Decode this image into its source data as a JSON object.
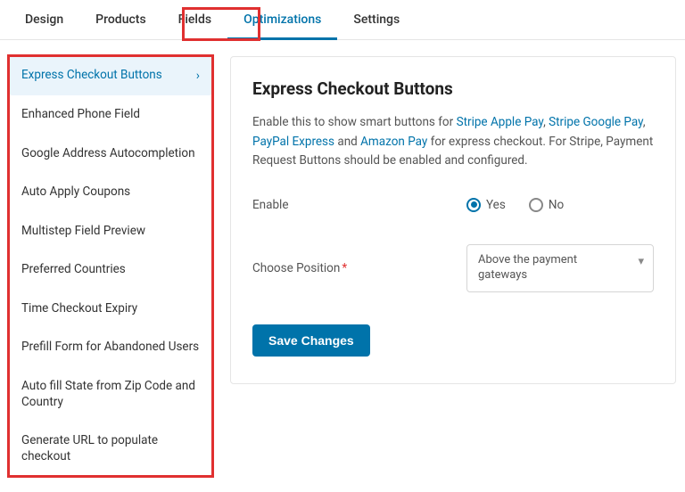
{
  "tabs": [
    "Design",
    "Products",
    "Fields",
    "Optimizations",
    "Settings"
  ],
  "activeTab": "Optimizations",
  "sidebar": {
    "items": [
      {
        "label": "Express Checkout Buttons",
        "active": true
      },
      {
        "label": "Enhanced Phone Field"
      },
      {
        "label": "Google Address Autocompletion"
      },
      {
        "label": "Auto Apply Coupons"
      },
      {
        "label": "Multistep Field Preview"
      },
      {
        "label": "Preferred Countries"
      },
      {
        "label": "Time Checkout Expiry"
      },
      {
        "label": "Prefill Form for Abandoned Users"
      },
      {
        "label": "Auto fill State from Zip Code and Country"
      },
      {
        "label": "Generate URL to populate checkout"
      }
    ]
  },
  "main": {
    "title": "Express Checkout Buttons",
    "desc_prefix": "Enable this to show smart buttons for ",
    "desc_links": [
      "Stripe Apple Pay",
      "Stripe Google Pay",
      "PayPal Express",
      "Amazon Pay"
    ],
    "desc_mid": " and ",
    "desc_sep": ", ",
    "desc_suffix": " for express checkout. For Stripe, Payment Request Buttons should be enabled and configured.",
    "enable_label": "Enable",
    "enable_options": {
      "yes": "Yes",
      "no": "No"
    },
    "enable_value": "yes",
    "position_label": "Choose Position",
    "position_value": "Above the payment gateways",
    "save_label": "Save Changes"
  }
}
